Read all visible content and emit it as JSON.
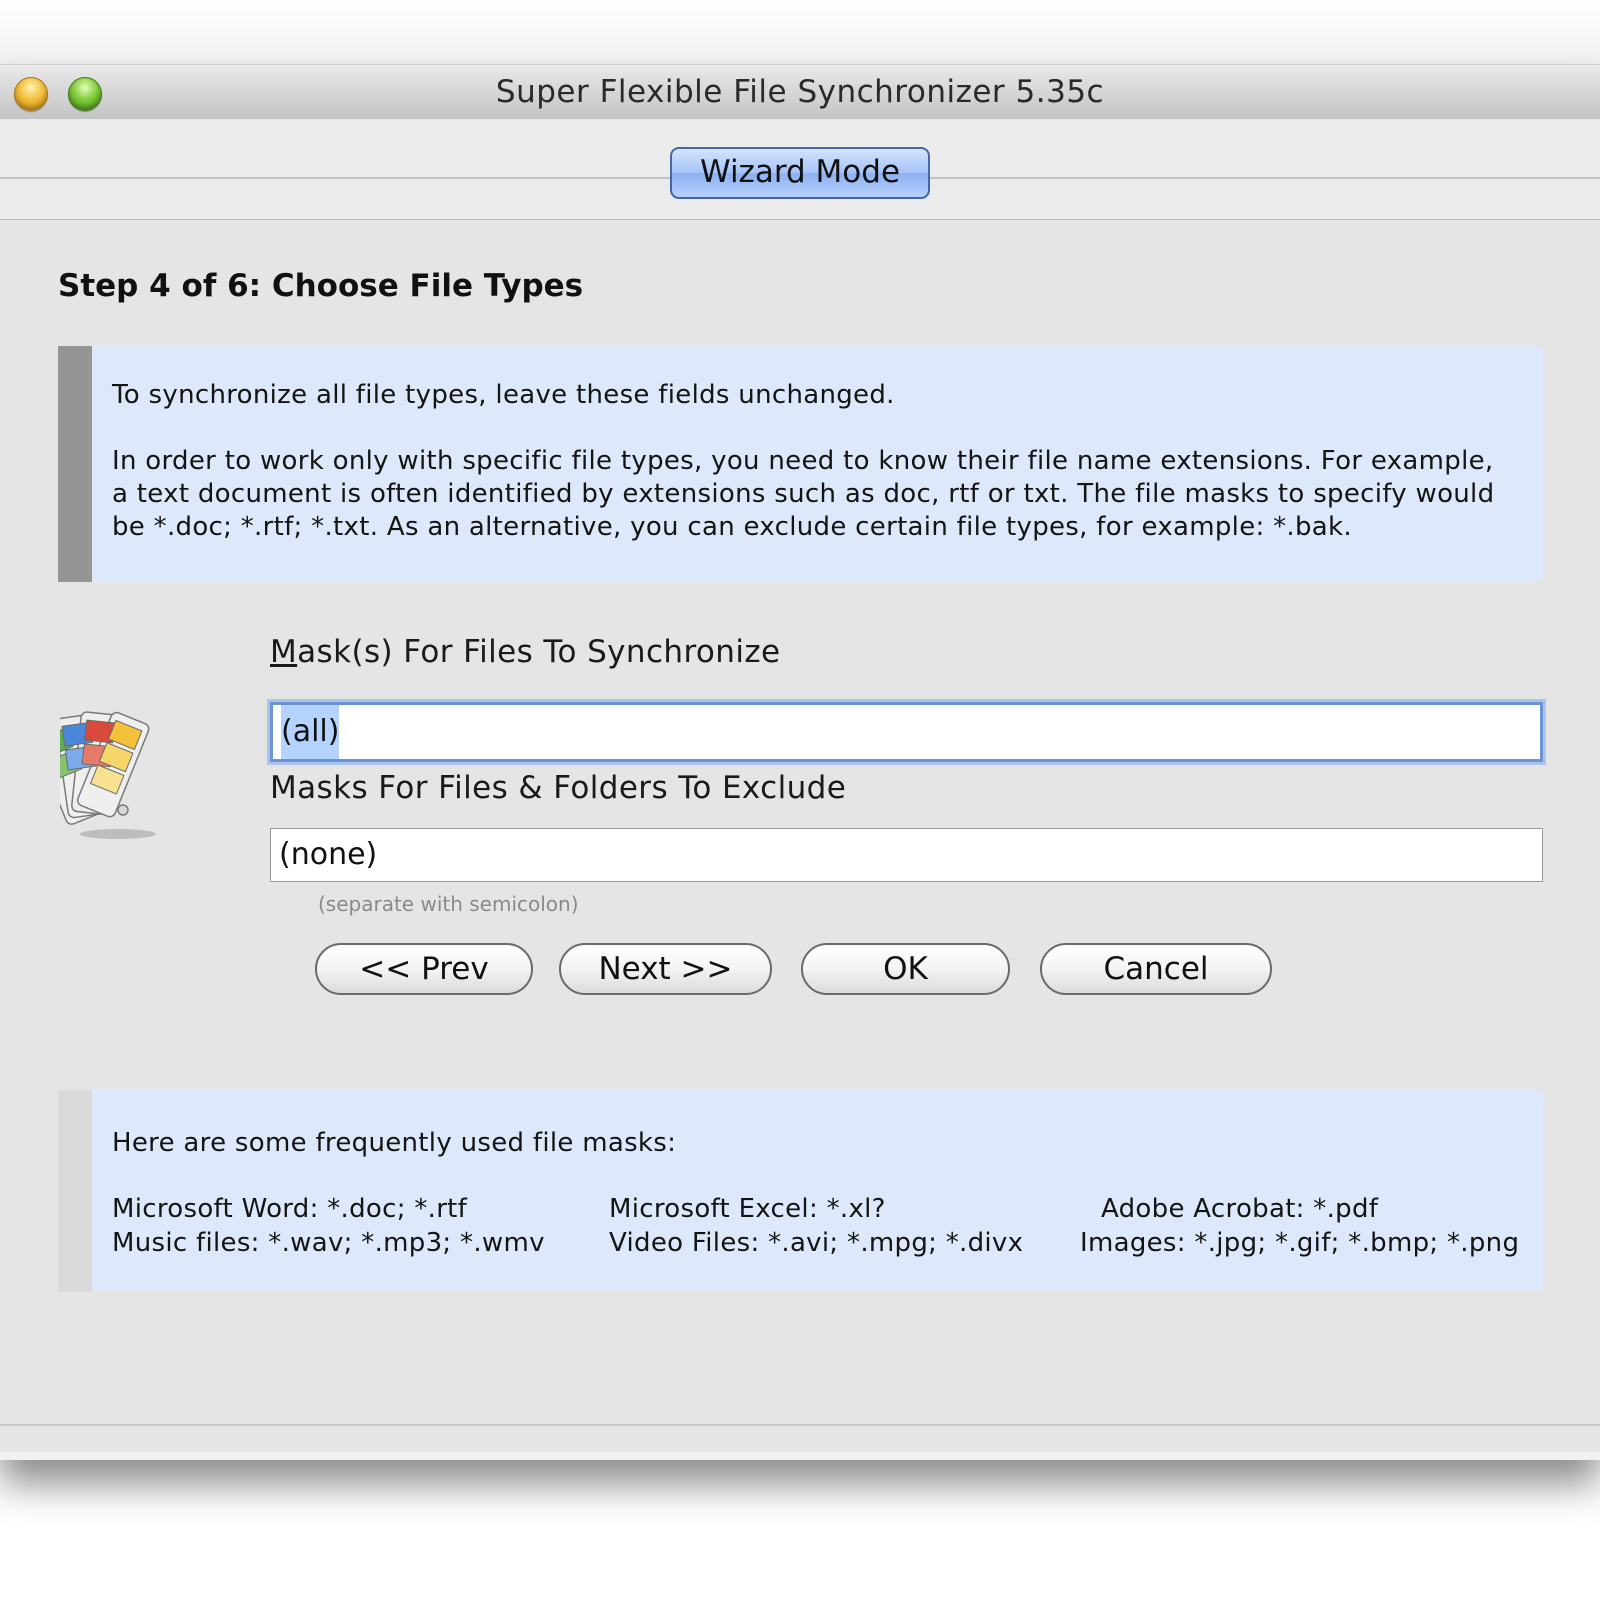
{
  "window": {
    "title": "Super Flexible File Synchronizer 5.35c"
  },
  "toolbar": {
    "mode_button_label": "Wizard Mode"
  },
  "step": {
    "title": "Step 4 of 6: Choose File Types"
  },
  "info": {
    "paragraph_1": "To synchronize all file types, leave these fields unchanged.",
    "paragraph_2_line_1": "In order to work only with specific file types, you need to know their file name extensions. For example,",
    "paragraph_2_line_2": "a text document is often identified by extensions such as doc, rtf or txt. The file masks to specify would",
    "paragraph_2_line_3": "be *.doc; *.rtf; *.txt. As an alternative, you can exclude certain file types, for example: *.bak."
  },
  "form": {
    "include_label_mnemonic": "M",
    "include_label_rest": "ask(s) For Files To Synchronize",
    "include_value": "(all)",
    "exclude_label": "Masks For Files & Folders To Exclude",
    "exclude_value": "(none)",
    "hint": "(separate with semicolon)",
    "icon": "file-types-fan-icon"
  },
  "buttons": {
    "prev": "<< Prev",
    "next": "Next >>",
    "ok": "OK",
    "cancel": "Cancel"
  },
  "masks": {
    "heading": "Here are some frequently used file masks:",
    "items": [
      "Microsoft Word: *.doc; *.rtf",
      "Microsoft Excel: *.xl?",
      "Adobe Acrobat: *.pdf",
      "Music files: *.wav; *.mp3; *.wmv",
      "Video Files: *.avi; *.mpg; *.divx",
      "Images: *.jpg; *.gif; *.bmp; *.png"
    ]
  },
  "colors": {
    "info_background": "#dde9fb",
    "focus_ring": "#6f94d6",
    "wizard_button": "#a5c3f7",
    "close_button": "#f2be3a",
    "zoom_button": "#7fcb3a"
  }
}
